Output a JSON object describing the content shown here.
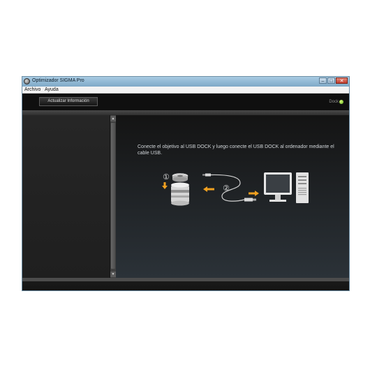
{
  "window": {
    "title": "Optimizador SIGMA Pro"
  },
  "window_controls": {
    "minimize": "–",
    "maximize": "□",
    "close": "✕"
  },
  "menu": {
    "archivo": "Archivo",
    "ayuda": "Ayuda"
  },
  "toolbar": {
    "update_label": "Actualizar Información",
    "dock_label": "Dock"
  },
  "main": {
    "instruction": "Conecte el objetivo al USB DOCK y luego conecte el USB DOCK al ordenador mediante el cable USB.",
    "steps": {
      "one": "①",
      "two": "②"
    }
  },
  "scroll": {
    "up": "▲",
    "down": "▼"
  },
  "colors": {
    "accent_arrow": "#f0a020",
    "dock_led": "#7ad52a"
  },
  "icons": [
    "app-icon",
    "lens-icon",
    "usb-dock-icon",
    "usb-cable-icon",
    "computer-icon",
    "arrow-icon"
  ]
}
